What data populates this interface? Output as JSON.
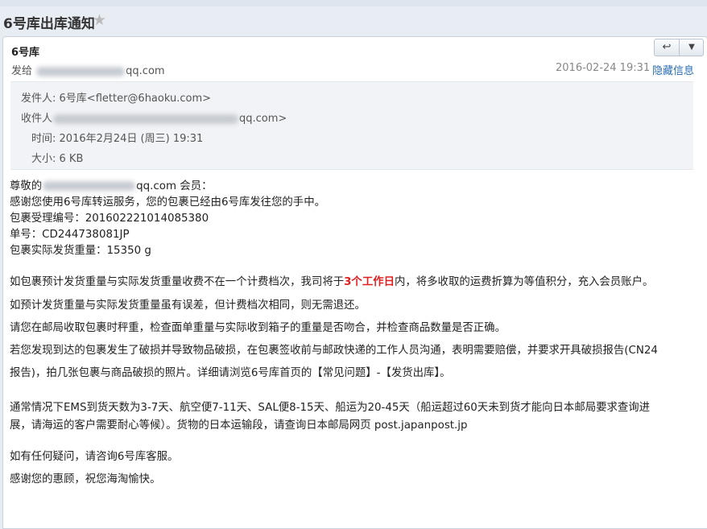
{
  "email": {
    "subject": "6号库出库通知",
    "star_icon": "star-icon",
    "sender_name": "6号库",
    "to_prefix": "发给",
    "to_visible": "qq.com",
    "date": "2016-02-24 19:31",
    "hide_info": "隐藏信息",
    "reply_icon": "reply-icon",
    "dropdown_icon": "chevron-down-icon"
  },
  "details": {
    "from_label": "发件人:",
    "from_value": "6号库<fletter@6haoku.com>",
    "to_label": "收件人",
    "to_value": "qq.com>",
    "time_label": "时间:",
    "time_value": "2016年2月24日 (周三) 19:31",
    "size_label": "大小:",
    "size_value": "6 KB"
  },
  "body": {
    "greet_prefix": "尊敬的",
    "greet_suffix": "qq.com 会员：",
    "line1": "感谢您使用6号库转运服务，您的包裹已经由6号库发往您的手中。",
    "line2": "包裹受理编号：201602221014085380",
    "line3": "单号：CD244738081JP",
    "line4": "包裹实际发货重量：15350 g",
    "p1_a": "如包裹预计发货重量与实际发货重量收费不在一个计费档次，我司将于",
    "p1_hl": "3个工作日",
    "p1_b": "内，将多收取的运费折算为等值积分，充入会员账户。",
    "p2": "如预计发货重量与实际发货重量虽有误差，但计费档次相同，则无需退还。",
    "p3": "请您在邮局收取包裹时秤重，检查面单重量与实际收到箱子的重量是否吻合，并检查商品数量是否正确。",
    "p4_a": "若您发现到达的包裹发生了破损并导致物品破损，在包裹签收前与邮政快递的工作人员沟通，表明需要赔偿，并要求开具破损报告(CN24",
    "p4_b": "报告)，拍几张包裹与商品破损的照片。详细请浏览6号库首页的【常见问题】-【发货出库】。",
    "p5_a": "通常情况下EMS到货天数为3-7天、航空便7-11天、SAL便8-15天、船运为20-45天（船运超过60天未到货才能向日本邮局要求查询进",
    "p5_b": "展，请海运的客户需要耐心等候）。货物的日本运输段，请查询日本邮局网页 post.japanpost.jp",
    "p6": "如有任何疑问，请咨询6号库客服。",
    "p7": "感谢您的惠顾，祝您海淘愉快。"
  }
}
